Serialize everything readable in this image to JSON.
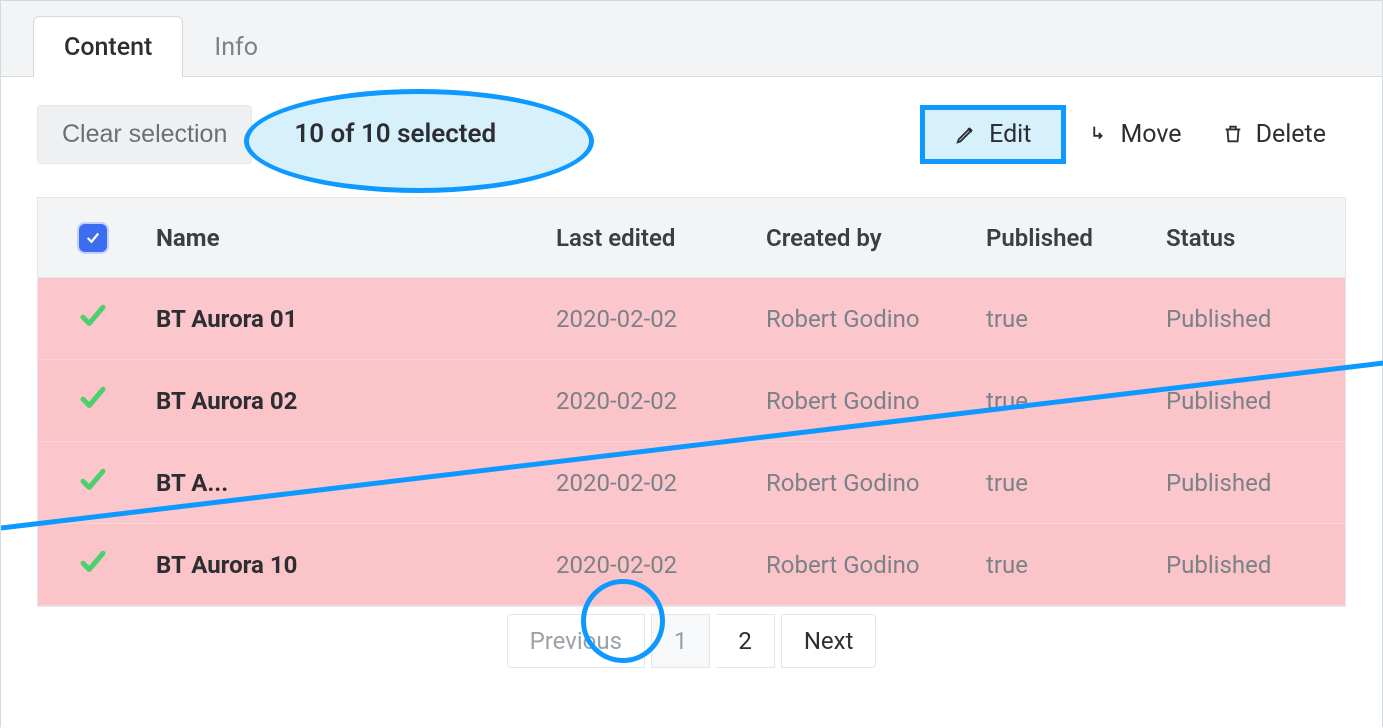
{
  "tabs": {
    "content": "Content",
    "info": "Info"
  },
  "toolbar": {
    "clear_selection": "Clear selection",
    "selection_count": "10 of 10 selected",
    "edit": "Edit",
    "move": "Move",
    "delete": "Delete"
  },
  "table": {
    "headers": {
      "name": "Name",
      "last_edited": "Last edited",
      "created_by": "Created by",
      "published": "Published",
      "status": "Status"
    },
    "rows": [
      {
        "name": "BT Aurora 01",
        "last_edited": "2020-02-02",
        "created_by": "Robert Godino",
        "published": "true",
        "status": "Published"
      },
      {
        "name": "BT Aurora 02",
        "last_edited": "2020-02-02",
        "created_by": "Robert Godino",
        "published": "true",
        "status": "Published"
      },
      {
        "name": "BT A...",
        "last_edited": "2020-02-02",
        "created_by": "Robert Godino",
        "published": "true",
        "status": "Published"
      },
      {
        "name": "BT Aurora 10",
        "last_edited": "2020-02-02",
        "created_by": "Robert Godino",
        "published": "true",
        "status": "Published"
      }
    ]
  },
  "pagination": {
    "previous": "Previous",
    "page1": "1",
    "page2": "2",
    "next": "Next"
  }
}
